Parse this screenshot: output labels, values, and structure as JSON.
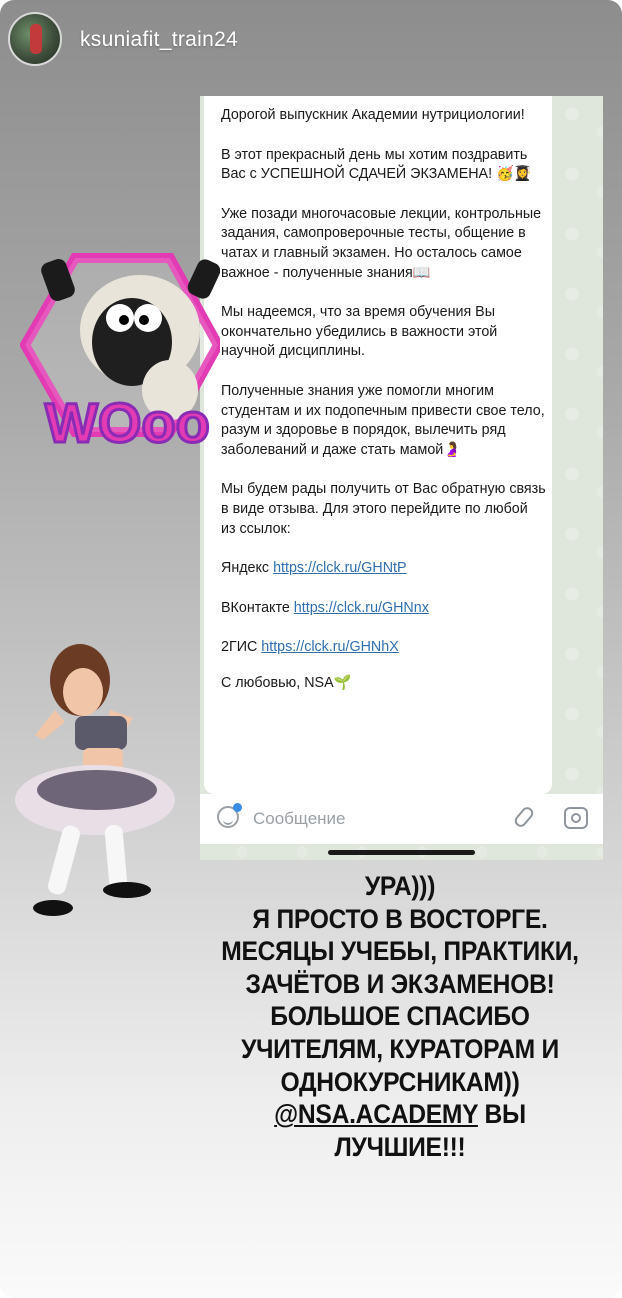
{
  "header": {
    "username": "ksuniafit_train24"
  },
  "chat": {
    "paragraphs": [
      "Дорогой выпускник Академии нутрициологии!",
      "В этот прекрасный день мы хотим поздравить Вас с УСПЕШНОЙ СДАЧЕЙ ЭКЗАМЕНА! 🥳👩‍🎓",
      "Уже позади многочасовые лекции, контрольные задания, самопроверочные тесты, общение в чатах и главный экзамен. Но осталось самое важное - полученные знания📖",
      "Мы надеемся, что за время обучения Вы окончательно убедились в важности этой научной дисциплины.",
      "Полученные знания уже помогли многим студентам и их подопечным привести свое тело, разум и здоровье в порядок, вылечить ряд заболеваний и даже стать мамой🤰",
      "Мы будем рады получить от Вас обратную связь в виде отзыва. Для этого перейдите по любой из ссылок:"
    ],
    "links": [
      {
        "label": "Яндекс",
        "url": "https://clck.ru/GHNtP"
      },
      {
        "label": "ВКонтакте",
        "url": "https://clck.ru/GHNnx"
      },
      {
        "label": "2ГИС",
        "url": "https://clck.ru/GHNhX"
      }
    ],
    "signature": "С любовью, NSA",
    "signature_emoji": "🌱",
    "input_placeholder": "Сообщение"
  },
  "stickers": {
    "sheep_text": "WOoo"
  },
  "caption": {
    "lines": [
      "УРА)))",
      "Я ПРОСТО В ВОСТОРГЕ.",
      "МЕСЯЦЫ УЧЕБЫ, ПРАКТИКИ,",
      "ЗАЧЁТОВ И ЭКЗАМЕНОВ!",
      "БОЛЬШОЕ СПАСИБО",
      "УЧИТЕЛЯМ, КУРАТОРАМ И",
      "ОДНОКУРСНИКАМ))"
    ],
    "mention": "@NSA.ACADEMY",
    "mention_suffix": " ВЫ",
    "last_line": "ЛУЧШИЕ!!!"
  },
  "colors": {
    "link": "#2f6fb0",
    "sticker_pink": "#e23bb3",
    "sticker_purple": "#8a2bb6"
  }
}
